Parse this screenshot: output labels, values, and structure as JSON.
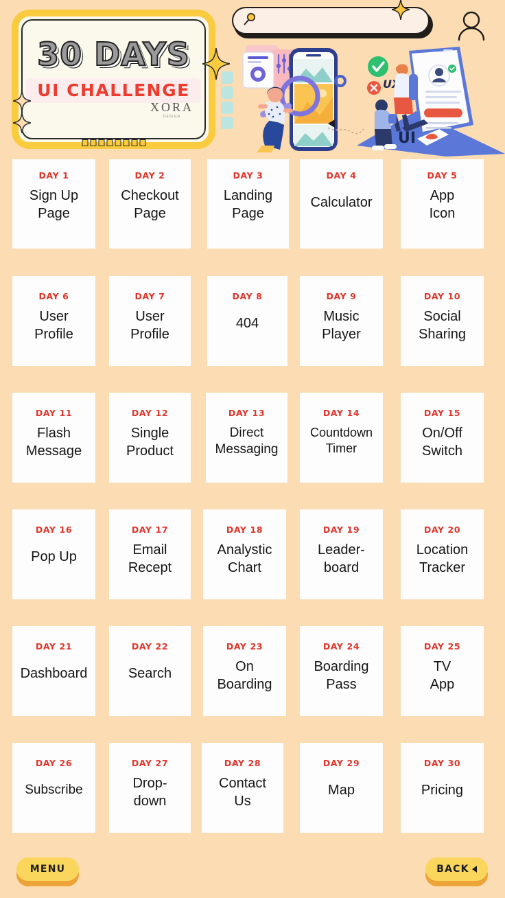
{
  "background_color": "#FBDCB3",
  "accent_red": "#E0352B",
  "accent_yellow": "#FBD65C",
  "header": {
    "banner": {
      "title_line1": "30 DAYS",
      "title_line2": "UI CHALLENGE",
      "brand_name": "XORA",
      "brand_sub": "DESIGN"
    },
    "search": {
      "value": "",
      "placeholder": "",
      "icon": "search-icon"
    },
    "account_icon": "person-icon",
    "illustrations": [
      {
        "name": "ui-design-illustration-left",
        "alt": "Woman with magnifying glass in front of a large phone"
      },
      {
        "name": "ux-design-illustration-right",
        "alt": "Isometric scene with people, laptop, UX and UI labels"
      }
    ]
  },
  "grid": {
    "rows": [
      [
        {
          "day": "DAY 1",
          "title": "Sign Up\nPage"
        },
        {
          "day": "DAY 2",
          "title": "Checkout\nPage"
        },
        {
          "day": "DAY 3",
          "title": "Landing\nPage"
        },
        {
          "day": "DAY 4",
          "title": "Calculator"
        },
        {
          "day": "DAY 5",
          "title": "App\nIcon"
        }
      ],
      [
        {
          "day": "DAY 6",
          "title": "User\nProfile"
        },
        {
          "day": "DAY 7",
          "title": "User\nProfile"
        },
        {
          "day": "DAY 8",
          "title": "404"
        },
        {
          "day": "DAY 9",
          "title": "Music\nPlayer"
        },
        {
          "day": "DAY 10",
          "title": "Social\nSharing"
        }
      ],
      [
        {
          "day": "DAY 11",
          "title": "Flash\nMessage"
        },
        {
          "day": "DAY 12",
          "title": "Single\nProduct"
        },
        {
          "day": "DAY 13",
          "title": "Direct\nMessaging"
        },
        {
          "day": "DAY 14",
          "title": "Countdown\nTimer"
        },
        {
          "day": "DAY 15",
          "title": "On/Off\nSwitch"
        }
      ],
      [
        {
          "day": "DAY 16",
          "title": "Pop Up"
        },
        {
          "day": "DAY 17",
          "title": "Email\nRecept"
        },
        {
          "day": "DAY 18",
          "title": "Analystic\nChart"
        },
        {
          "day": "DAY 19",
          "title": "Leader-\nboard"
        },
        {
          "day": "DAY 20",
          "title": "Location\nTracker"
        }
      ],
      [
        {
          "day": "DAY 21",
          "title": "Dashboard"
        },
        {
          "day": "DAY 22",
          "title": "Search"
        },
        {
          "day": "DAY 23",
          "title": "On\nBoarding"
        },
        {
          "day": "DAY 24",
          "title": "Boarding\nPass"
        },
        {
          "day": "DAY 25",
          "title": "TV\nApp"
        }
      ],
      [
        {
          "day": "DAY 26",
          "title": "Subscribe"
        },
        {
          "day": "DAY 27",
          "title": "Drop-\ndown"
        },
        {
          "day": "DAY 28",
          "title": "Contact\nUs"
        },
        {
          "day": "DAY 29",
          "title": "Map"
        },
        {
          "day": "DAY 30",
          "title": "Pricing"
        }
      ]
    ]
  },
  "footer": {
    "menu_label": "MENU",
    "back_label": "BACK",
    "back_icon": "triangle-left-icon"
  }
}
